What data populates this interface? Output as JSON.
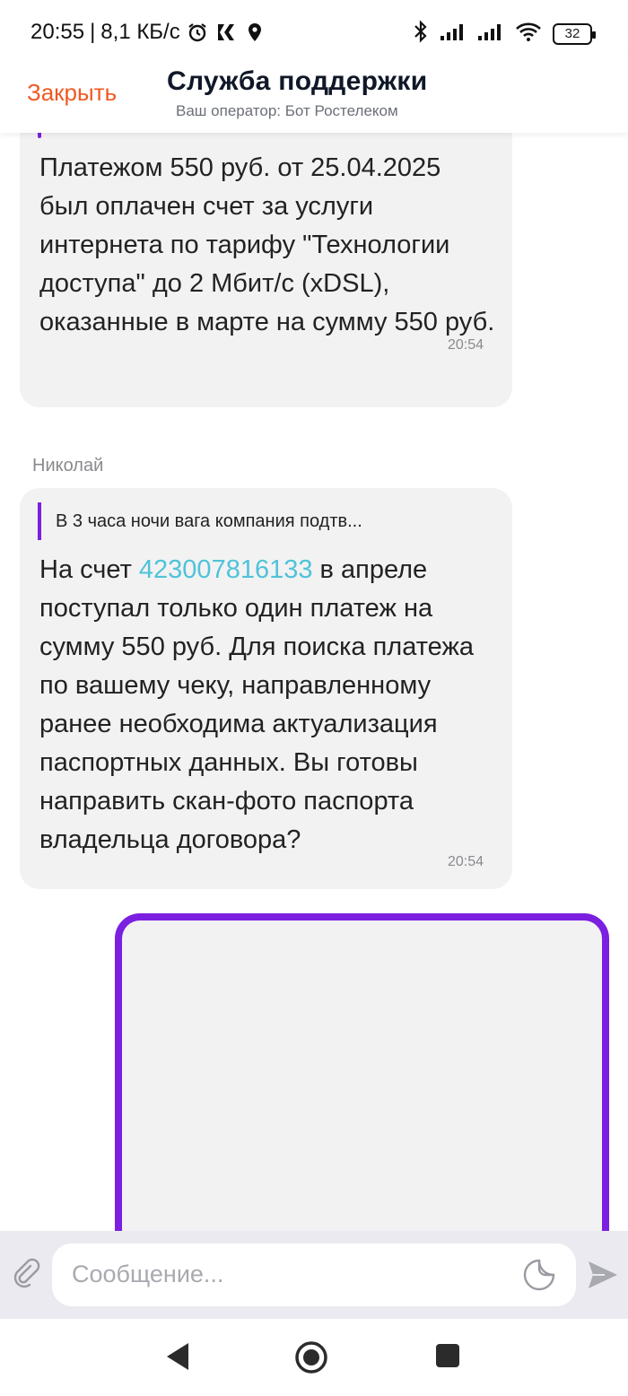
{
  "status_bar": {
    "time": "20:55",
    "speed": "8,1 КБ/с",
    "battery": "32"
  },
  "header": {
    "close_label": "Закрыть",
    "title": "Служба поддержки",
    "subtitle": "Ваш оператор: Бот Ростелеком"
  },
  "messages": [
    {
      "text": "Платежом 550 руб. от 25.04.2025 был оплачен счет за услуги интернета по тарифу \"Технологии доступа\" до 2 Мбит/с (xDSL), оказанные в марте на сумму 550 руб.",
      "time": "20:54"
    },
    {
      "author": "Николай",
      "quote": "В 3 часа ночи вага компания подтв...",
      "text_before": "На счет ",
      "link": "423007816133",
      "text_after": " в апреле поступал только один платеж на сумму 550 руб. Для поиска платежа по вашему чеку, направленному ранее необходима актуализация паспортных данных. Вы готовы направить скан-фото паспорта владельца договора?",
      "time": "20:54"
    }
  ],
  "composer": {
    "placeholder": "Сообщение..."
  },
  "colors": {
    "accent": "#7b1fe0",
    "close": "#f05a22",
    "link": "#4fc3d9",
    "bubble": "#f2f2f3"
  },
  "icons": [
    "alarm-icon",
    "k-logo-icon",
    "location-icon",
    "bluetooth-icon",
    "signal-icon",
    "wifi-icon",
    "battery-icon",
    "paperclip-icon",
    "sticker-icon",
    "send-icon",
    "back-icon",
    "home-icon",
    "recents-icon"
  ]
}
